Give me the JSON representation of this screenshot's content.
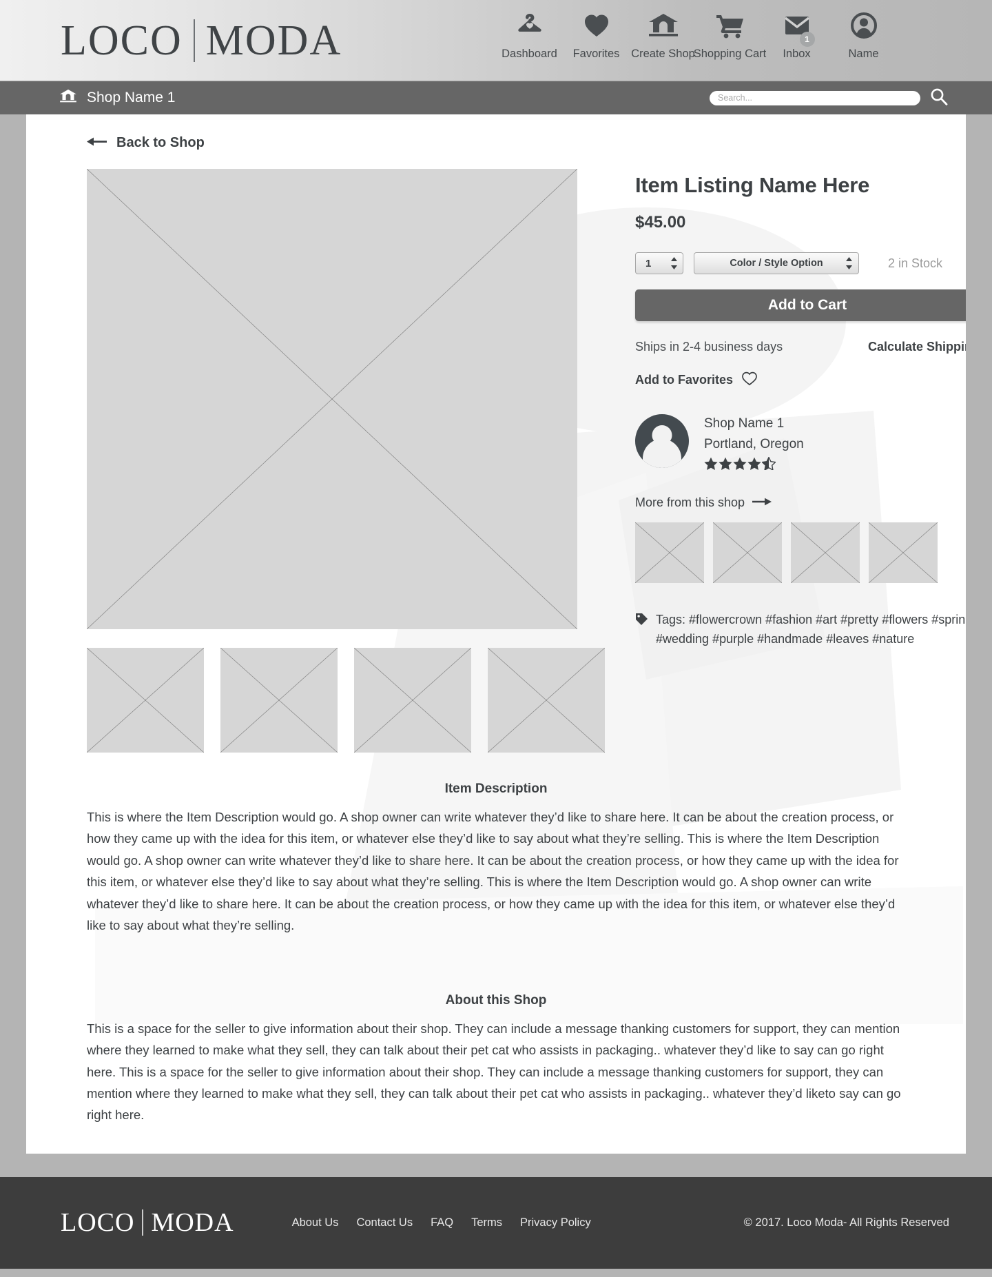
{
  "brand": {
    "word1": "LOCO",
    "word2": "MODA"
  },
  "nav": [
    {
      "label": "Dashboard",
      "icon": "hanger-icon"
    },
    {
      "label": "Favorites",
      "icon": "heart-icon"
    },
    {
      "label": "Create Shop",
      "icon": "shop-house-icon"
    },
    {
      "label": "Shopping Cart",
      "icon": "shopping-cart-icon"
    },
    {
      "label": "Inbox",
      "icon": "envelope-icon",
      "badge": "1"
    },
    {
      "label": "Name",
      "icon": "user-avatar-icon"
    }
  ],
  "shop_bar": {
    "shop_name": "Shop Name 1",
    "home_icon": "shop-house-icon",
    "search_placeholder": "Search...",
    "search_value": "",
    "search_icon": "search-icon"
  },
  "back_link": {
    "label": "Back to Shop",
    "icon": "arrow-left-icon"
  },
  "product": {
    "title": "Item Listing Name Here",
    "price": "$45.00",
    "quantity": "1",
    "option_label": "Color / Style Option",
    "stock": "2 in Stock",
    "add_to_cart": "Add to Cart",
    "shipping_note": "Ships in 2-4 business days",
    "calculate_shipping": "Calculate Shipping",
    "add_to_favorites": "Add to Favorites"
  },
  "shop_card": {
    "name": "Shop Name 1",
    "location": "Portland, Oregon",
    "rating": 4.5
  },
  "more_from_shop": {
    "label": "More from this shop",
    "icon": "arrow-right-icon",
    "count": 4
  },
  "tags": {
    "icon": "tag-icon",
    "label": "Tags:",
    "list": "#flowercrown #fashion #art #pretty #flowers #spring #wedding #purple #handmade #leaves #nature"
  },
  "sections": {
    "description_title": "Item Description",
    "description_body": "This is where the Item Description would go.  A shop owner can write whatever they’d like to share here.  It can be about the creation process, or how they came up with the idea for this item, or whatever else they’d like to say about what they’re selling.  This is where the Item Description would go.  A shop owner can write whatever they’d like to share here.  It can be about the creation process, or how they came up with the idea for this item, or whatever else they’d like to say about what they’re selling.  This is where the Item Description would go.  A shop owner can write whatever they’d like to share here.  It can be about the creation process, or how they came up with the idea for this item, or whatever else they’d like to say about what they’re selling.",
    "about_title": "About this Shop",
    "about_body": "This is a space for the seller to give information about their shop.  They can include a message thanking customers for support, they can mention where they learned to make what they sell, they can talk about their pet cat who assists in packaging.. whatever they’d like to say can go right here.  This is a space for the seller to give information about their shop.  They can include a message thanking customers for support, they can mention where they learned to make what they sell, they can talk about their pet cat who assists in packaging.. whatever they’d liketo say can go right here."
  },
  "gallery": {
    "main_alt": "main-product-image",
    "thumb_count": 4
  },
  "footer": {
    "links": [
      "About Us",
      "Contact Us",
      "FAQ",
      "Terms",
      "Privacy Policy"
    ],
    "copyright": "© 2017.  Loco Moda- All Rights Reserved"
  },
  "colors": {
    "header_bg": "#d2d2d2",
    "shop_bar": "#666666",
    "footer_bg": "#3d3d3d",
    "page_bg": "#b4b4b4",
    "dark_text": "#3d4144",
    "placeholder_fill": "#d6d6d6"
  }
}
